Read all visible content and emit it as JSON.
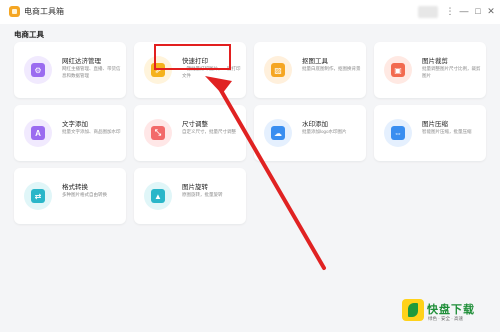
{
  "window": {
    "title": "电商工具箱",
    "controls": [
      "⋮",
      "—",
      "□",
      "✕"
    ]
  },
  "section_title": "电商工具",
  "cards": [
    {
      "title": "网红达济管理",
      "desc": "网红主播管理、直播、带货信息和数据管理",
      "icon": "user-manage-icon",
      "color": "#9b6cf0",
      "bg": "#f1eafe",
      "glyph": "⚙"
    },
    {
      "title": "快速打印",
      "desc": "一键批量打印图片，一键打印文件",
      "icon": "print-icon",
      "color": "#f5b21c",
      "bg": "#fff4dc",
      "glyph": "⇗"
    },
    {
      "title": "抠图工具",
      "desc": "批量白底图制作，抠图换背景",
      "icon": "cutout-icon",
      "color": "#f5a623",
      "bg": "#fff0dc",
      "glyph": "▨"
    },
    {
      "title": "图片裁剪",
      "desc": "批量调整图片尺寸比例，裁剪图片",
      "icon": "crop-icon",
      "color": "#f26a4f",
      "bg": "#ffe9e3",
      "glyph": "▣"
    },
    {
      "title": "文字添加",
      "desc": "批量文字添加、商品图加水印",
      "icon": "text-add-icon",
      "color": "#9b6cf0",
      "bg": "#f1eafe",
      "glyph": "A"
    },
    {
      "title": "尺寸调整",
      "desc": "自定义尺寸，批量尺寸调整",
      "icon": "resize-icon",
      "color": "#f26a6a",
      "bg": "#ffe7e7",
      "glyph": "⤡"
    },
    {
      "title": "水印添加",
      "desc": "批量添加logo水印图片",
      "icon": "watermark-icon",
      "color": "#3a8ef0",
      "bg": "#e5f0fe",
      "glyph": "☁"
    },
    {
      "title": "图片压缩",
      "desc": "智能图片压缩，批量压缩",
      "icon": "compress-icon",
      "color": "#3a8ef0",
      "bg": "#e5f0fe",
      "glyph": "⇔"
    },
    {
      "title": "格式转换",
      "desc": "多种图片格式自由转换",
      "icon": "format-convert-icon",
      "color": "#29b6c9",
      "bg": "#e0f6f8",
      "glyph": "⇄"
    },
    {
      "title": "图片旋转",
      "desc": "原图旋转，批量旋转",
      "icon": "rotate-icon",
      "color": "#29b6c9",
      "bg": "#e0f6f8",
      "glyph": "▲"
    }
  ],
  "watermark": {
    "name": "快盘下载",
    "slogan": "绿色 · 安全 · 高速"
  }
}
